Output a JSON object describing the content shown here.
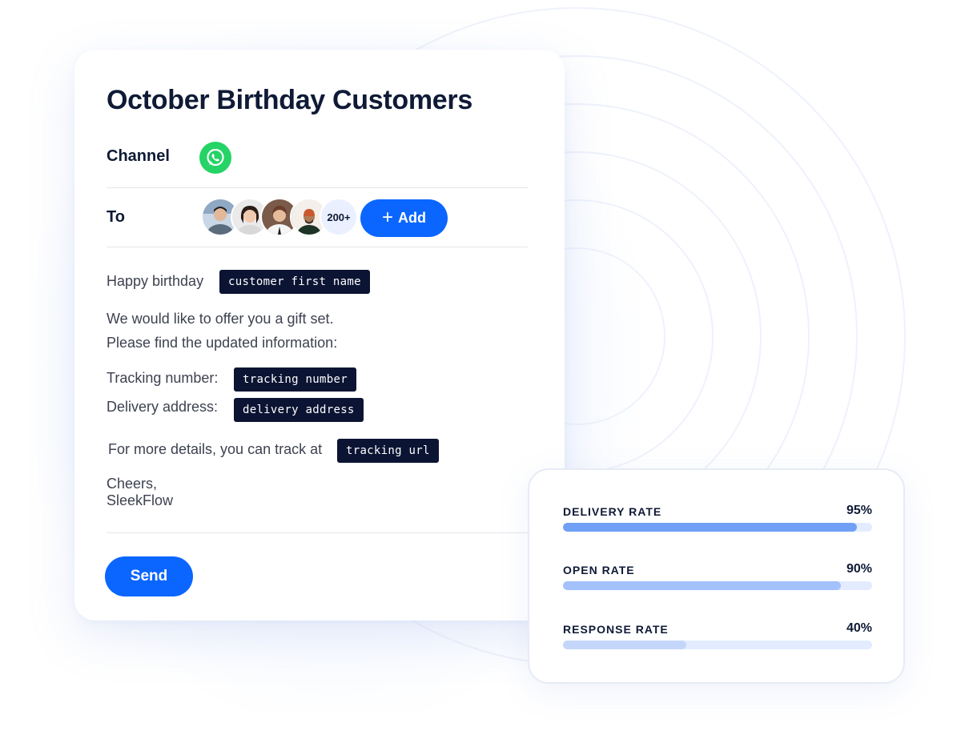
{
  "campaign": {
    "title": "October Birthday Customers",
    "channel_label": "Channel",
    "channel_icon": "whatsapp-icon",
    "to_label": "To",
    "recipient_count": "200+",
    "add_button": "+ Add",
    "add_button_text": "Add"
  },
  "message": {
    "greeting": "Happy birthday",
    "var_first_name": "customer first name",
    "line1": "We would like to offer you a gift set.",
    "line2": "Please find the updated information:",
    "tracking_label": "Tracking number:",
    "var_tracking_number": "tracking number",
    "address_label": "Delivery address:",
    "var_delivery_address": "delivery address",
    "details_text": "For more details, you can track at",
    "var_tracking_url": "tracking url",
    "signoff": "Cheers,",
    "sender": "SleekFlow"
  },
  "actions": {
    "send": "Send"
  },
  "colors": {
    "primary": "#0a66ff",
    "whatsapp": "#25d366",
    "variable_bg": "#0b1433",
    "bar_track": "#e3ecff"
  },
  "stats": [
    {
      "label": "DELIVERY RATE",
      "value_text": "95%",
      "value": 95,
      "color": "#6fa0f5"
    },
    {
      "label": "OPEN RATE",
      "value_text": "90%",
      "value": 90,
      "color": "#a3c1fa"
    },
    {
      "label": "RESPONSE RATE",
      "value_text": "40%",
      "value": 40,
      "color": "#c4d7fb"
    }
  ]
}
